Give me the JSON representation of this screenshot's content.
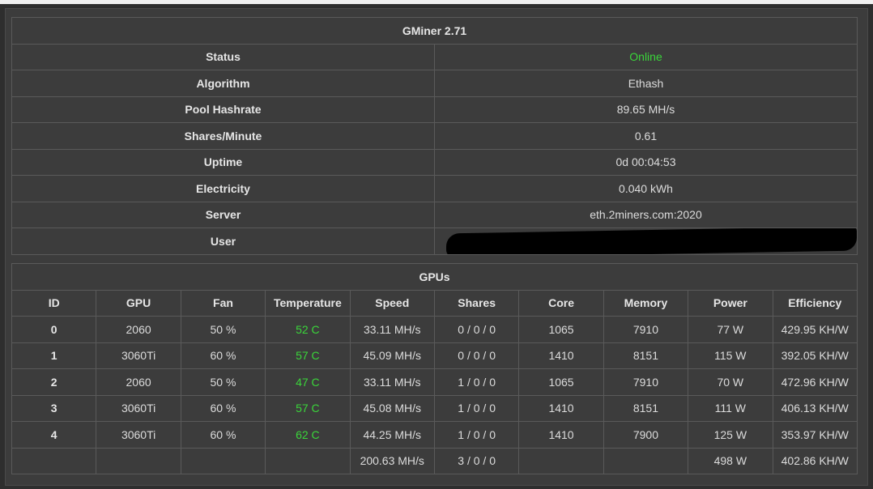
{
  "info": {
    "title": "GMiner 2.71",
    "rows": [
      {
        "label": "Status",
        "value": "Online"
      },
      {
        "label": "Algorithm",
        "value": "Ethash"
      },
      {
        "label": "Pool Hashrate",
        "value": "89.65 MH/s"
      },
      {
        "label": "Shares/Minute",
        "value": "0.61"
      },
      {
        "label": "Uptime",
        "value": "0d 00:04:53"
      },
      {
        "label": "Electricity",
        "value": "0.040 kWh"
      },
      {
        "label": "Server",
        "value": "eth.2miners.com:2020"
      },
      {
        "label": "User",
        "value": ""
      }
    ],
    "status_color": "#3ad63a"
  },
  "gpus": {
    "title": "GPUs",
    "headers": [
      "ID",
      "GPU",
      "Fan",
      "Temperature",
      "Speed",
      "Shares",
      "Core",
      "Memory",
      "Power",
      "Efficiency"
    ],
    "rows": [
      {
        "id": "0",
        "gpu": "2060",
        "fan": "50 %",
        "temp": "52 C",
        "speed": "33.11 MH/s",
        "shares": "0 / 0 / 0",
        "core": "1065",
        "memory": "7910",
        "power": "77 W",
        "efficiency": "429.95 KH/W"
      },
      {
        "id": "1",
        "gpu": "3060Ti",
        "fan": "60 %",
        "temp": "57 C",
        "speed": "45.09 MH/s",
        "shares": "0 / 0 / 0",
        "core": "1410",
        "memory": "8151",
        "power": "115 W",
        "efficiency": "392.05 KH/W"
      },
      {
        "id": "2",
        "gpu": "2060",
        "fan": "50 %",
        "temp": "47 C",
        "speed": "33.11 MH/s",
        "shares": "1 / 0 / 0",
        "core": "1065",
        "memory": "7910",
        "power": "70 W",
        "efficiency": "472.96 KH/W"
      },
      {
        "id": "3",
        "gpu": "3060Ti",
        "fan": "60 %",
        "temp": "57 C",
        "speed": "45.08 MH/s",
        "shares": "1 / 0 / 0",
        "core": "1410",
        "memory": "8151",
        "power": "111 W",
        "efficiency": "406.13 KH/W"
      },
      {
        "id": "4",
        "gpu": "3060Ti",
        "fan": "60 %",
        "temp": "62 C",
        "speed": "44.25 MH/s",
        "shares": "1 / 0 / 0",
        "core": "1410",
        "memory": "7900",
        "power": "125 W",
        "efficiency": "353.97 KH/W"
      }
    ],
    "totals": {
      "speed": "200.63 MH/s",
      "shares": "3 / 0 / 0",
      "power": "498 W",
      "efficiency": "402.86 KH/W"
    },
    "temp_color": "#3ad63a"
  }
}
